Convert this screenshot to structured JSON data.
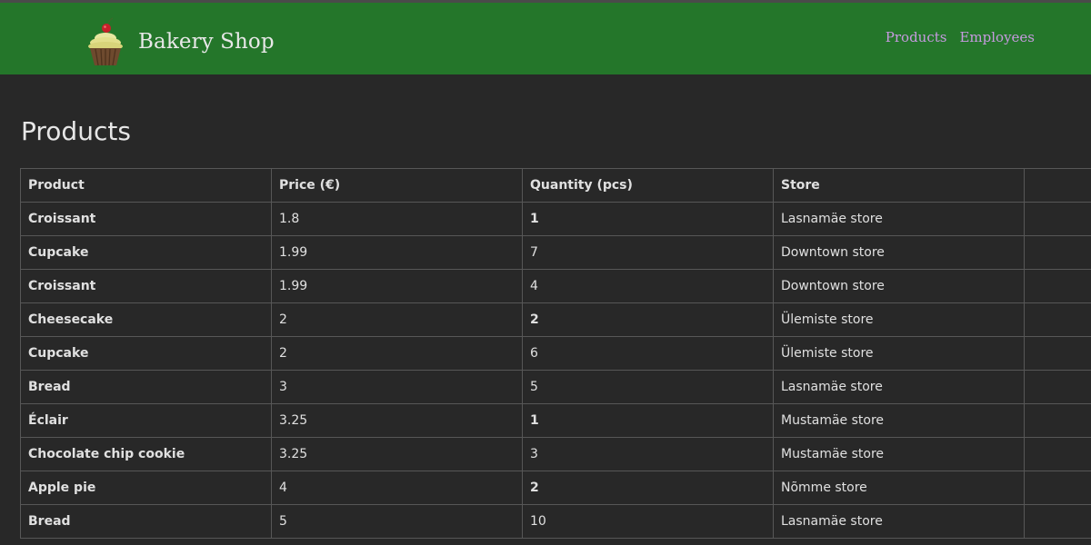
{
  "header": {
    "brand_title": "Bakery Shop",
    "logo_icon": "cupcake-icon",
    "nav": [
      {
        "label": "Products"
      },
      {
        "label": "Employees"
      }
    ],
    "colors": {
      "navbar_bg": "#24762a",
      "nav_link": "#c79ae0"
    }
  },
  "main": {
    "title": "Products",
    "table": {
      "columns": [
        "Product",
        "Price (€)",
        "Quantity (pcs)",
        "Store",
        ""
      ],
      "rows": [
        {
          "product": "Croissant",
          "price": "1.8",
          "quantity": "1",
          "store": "Lasnamäe store"
        },
        {
          "product": "Cupcake",
          "price": "1.99",
          "quantity": "7",
          "store": "Downtown store"
        },
        {
          "product": "Croissant",
          "price": "1.99",
          "quantity": "4",
          "store": "Downtown store"
        },
        {
          "product": "Cheesecake",
          "price": "2",
          "quantity": "2",
          "store": "Ülemiste store"
        },
        {
          "product": "Cupcake",
          "price": "2",
          "quantity": "6",
          "store": "Ülemiste store"
        },
        {
          "product": "Bread",
          "price": "3",
          "quantity": "5",
          "store": "Lasnamäe store"
        },
        {
          "product": "Éclair",
          "price": "3.25",
          "quantity": "1",
          "store": "Mustamäe store"
        },
        {
          "product": "Chocolate chip cookie",
          "price": "3.25",
          "quantity": "3",
          "store": "Mustamäe store"
        },
        {
          "product": "Apple pie",
          "price": "4",
          "quantity": "2",
          "store": "Nõmme store"
        },
        {
          "product": "Bread",
          "price": "5",
          "quantity": "10",
          "store": "Lasnamäe store"
        }
      ]
    }
  }
}
